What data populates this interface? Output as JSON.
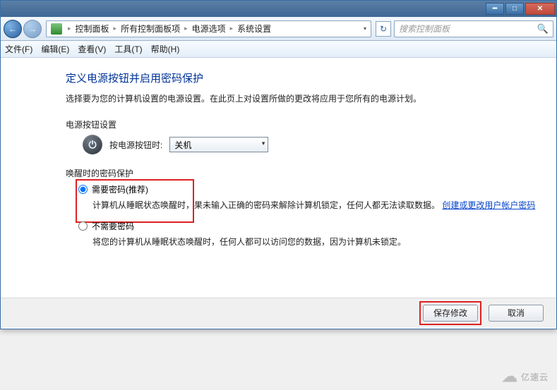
{
  "titlebar": {
    "title_blurred": ""
  },
  "breadcrumb": {
    "seg1": "控制面板",
    "seg2": "所有控制面板项",
    "seg3": "电源选项",
    "seg4": "系统设置"
  },
  "search": {
    "placeholder": "搜索控制面板"
  },
  "menubar": {
    "file": "文件(F)",
    "edit": "编辑(E)",
    "view": "查看(V)",
    "tools": "工具(T)",
    "help": "帮助(H)"
  },
  "page": {
    "headline": "定义电源按钮并启用密码保护",
    "desc": "选择要为您的计算机设置的电源设置。在此页上对设置所做的更改将应用于您所有的电源计划。",
    "power_section": "电源按钮设置",
    "power_label": "按电源按钮时:",
    "power_value": "关机",
    "wake_section": "唤醒时的密码保护",
    "opt1_label": "需要密码(推荐)",
    "opt1_body_a": "计算机从睡眠状态唤醒时，",
    "opt1_body_b": "果未输入正确的密码来解除计算机锁定，任何人都无法读取数据。",
    "opt1_link": "创建或更改用户帐户密码",
    "opt2_label": "不需要密码",
    "opt2_body": "将您的计算机从睡眠状态唤醒时，任何人都可以访问您的数据，因为计算机未锁定。"
  },
  "buttons": {
    "save": "保存修改",
    "cancel": "取消"
  },
  "watermark": "亿速云"
}
